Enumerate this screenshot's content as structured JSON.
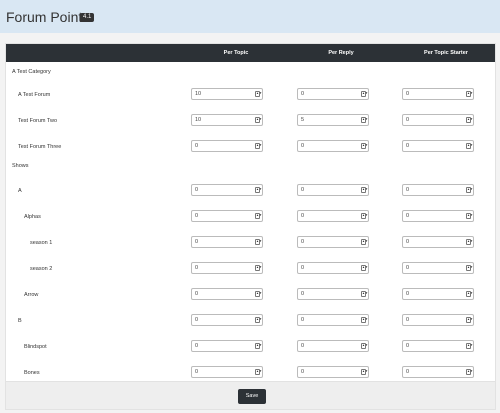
{
  "header": {
    "title": "Forum Points",
    "version": "4.1"
  },
  "columns": [
    "Per Topic",
    "Per Reply",
    "Per Topic Starter"
  ],
  "rows": [
    {
      "label": "A Test Category",
      "type": "category",
      "indent": 0,
      "values": null
    },
    {
      "label": "A Test Forum",
      "type": "forum",
      "indent": 1,
      "values": [
        "10",
        "0",
        "0"
      ]
    },
    {
      "label": "Test Forum Two",
      "type": "forum",
      "indent": 1,
      "values": [
        "10",
        "5",
        "0"
      ]
    },
    {
      "label": "Test Forum Three",
      "type": "forum",
      "indent": 1,
      "values": [
        "0",
        "0",
        "0"
      ]
    },
    {
      "label": "Shows",
      "type": "category",
      "indent": 0,
      "values": null
    },
    {
      "label": "A",
      "type": "forum",
      "indent": 1,
      "values": [
        "0",
        "0",
        "0"
      ]
    },
    {
      "label": "Alphas",
      "type": "forum",
      "indent": 2,
      "values": [
        "0",
        "0",
        "0"
      ]
    },
    {
      "label": "season 1",
      "type": "forum",
      "indent": 3,
      "values": [
        "0",
        "0",
        "0"
      ]
    },
    {
      "label": "season 2",
      "type": "forum",
      "indent": 3,
      "values": [
        "0",
        "0",
        "0"
      ]
    },
    {
      "label": "Arrow",
      "type": "forum",
      "indent": 2,
      "values": [
        "0",
        "0",
        "0"
      ]
    },
    {
      "label": "B",
      "type": "forum",
      "indent": 1,
      "values": [
        "0",
        "0",
        "0"
      ]
    },
    {
      "label": "Blindspot",
      "type": "forum",
      "indent": 2,
      "values": [
        "0",
        "0",
        "0"
      ]
    },
    {
      "label": "Bones",
      "type": "forum",
      "indent": 2,
      "values": [
        "0",
        "0",
        "0"
      ]
    }
  ],
  "footer": {
    "save_label": "Save"
  }
}
